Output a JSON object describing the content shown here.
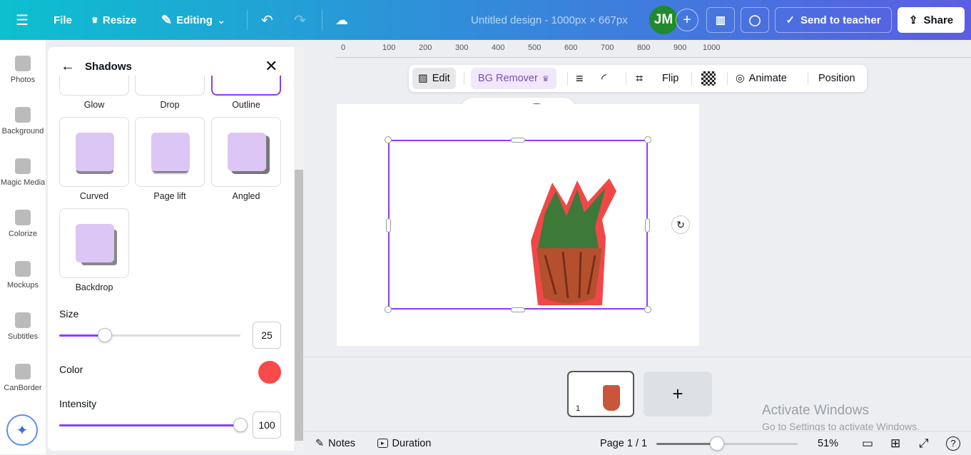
{
  "topbar": {
    "file": "File",
    "resize": "Resize",
    "editing": "Editing",
    "title": "Untitled design - 1000px × 667px",
    "avatar": "JM",
    "send": "Send to teacher",
    "share": "Share"
  },
  "rail": [
    {
      "label": "Photos"
    },
    {
      "label": "Background"
    },
    {
      "label": "Magic Media"
    },
    {
      "label": "Colorize"
    },
    {
      "label": "Mockups"
    },
    {
      "label": "Subtitles"
    },
    {
      "label": "CanBorder"
    }
  ],
  "panel": {
    "title": "Shadows",
    "top_row": [
      "Glow",
      "Drop",
      "Outline"
    ],
    "effects": [
      "Curved",
      "Page lift",
      "Angled",
      "Backdrop"
    ],
    "size_label": "Size",
    "size_value": "25",
    "size_fraction": 0.25,
    "color_label": "Color",
    "color": "#f84a4a",
    "intensity_label": "Intensity",
    "intensity_value": "100",
    "intensity_fraction": 1.0
  },
  "ruler": [
    "0",
    "100",
    "200",
    "300",
    "400",
    "500",
    "600",
    "700",
    "800",
    "900",
    "1000"
  ],
  "toolbar": {
    "edit": "Edit",
    "bg_remover": "BG Remover",
    "flip": "Flip",
    "animate": "Animate",
    "position": "Position"
  },
  "pages": {
    "thumb_number": "1",
    "add": "+"
  },
  "bottom": {
    "notes": "Notes",
    "duration": "Duration",
    "page": "Page 1 / 1",
    "zoom": "51%",
    "zoom_fraction": 0.43
  },
  "watermark": {
    "title": "Activate Windows",
    "sub": "Go to Settings to activate Windows."
  },
  "accent": "#8b3dff"
}
